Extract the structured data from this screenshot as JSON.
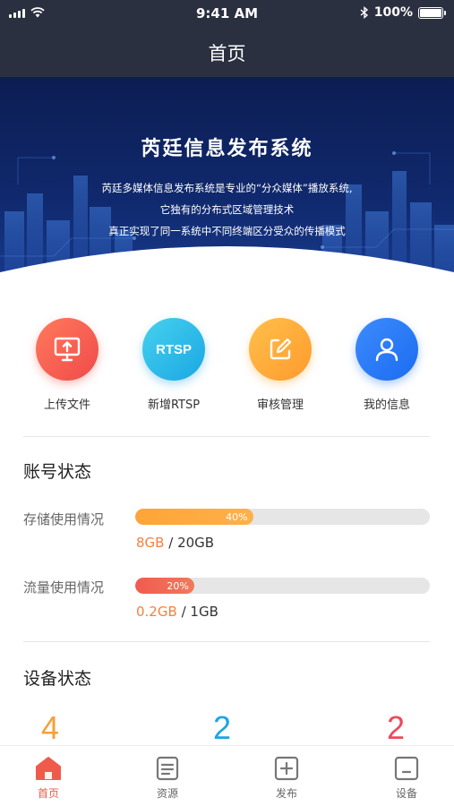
{
  "status_bar": {
    "time": "9:41 AM",
    "battery": "100%"
  },
  "nav": {
    "title": "首页"
  },
  "banner": {
    "title": "芮廷信息发布系统",
    "lines": [
      "芮廷多媒体信息发布系统是专业的“分众媒体”播放系统,",
      "它独有的分布式区域管理技术",
      "真正实现了同一系统中不同终端区分受众的传播模式"
    ]
  },
  "actions": [
    {
      "label": "上传文件",
      "icon": "upload-monitor-icon"
    },
    {
      "label": "新增RTSP",
      "icon": "rtsp-icon",
      "icon_text": "RTSP"
    },
    {
      "label": "审核管理",
      "icon": "edit-icon"
    },
    {
      "label": "我的信息",
      "icon": "user-icon"
    }
  ],
  "account": {
    "title": "账号状态",
    "storage": {
      "label": "存储使用情况",
      "percent": 40,
      "percent_text": "40%",
      "used": "8GB",
      "separator": "/",
      "total": "20GB"
    },
    "traffic": {
      "label": "流量使用情况",
      "percent": 20,
      "percent_text": "20%",
      "used": "0.2GB",
      "separator": "/",
      "total": "1GB"
    }
  },
  "devices": {
    "title": "设备状态",
    "counts": [
      {
        "value": "4",
        "color": "#f5a03c"
      },
      {
        "value": "2",
        "color": "#1fa4e4"
      },
      {
        "value": "2",
        "color": "#ee4a5a"
      }
    ]
  },
  "tabbar": {
    "items": [
      {
        "label": "首页",
        "icon": "home-icon",
        "active": true
      },
      {
        "label": "资源",
        "icon": "document-icon",
        "active": false
      },
      {
        "label": "发布",
        "icon": "plus-box-icon",
        "active": false
      },
      {
        "label": "设备",
        "icon": "device-icon",
        "active": false
      }
    ]
  },
  "colors": {
    "accent": "#f05a4a",
    "header_bg": "#2b3040",
    "banner_bg": "#10296e"
  }
}
